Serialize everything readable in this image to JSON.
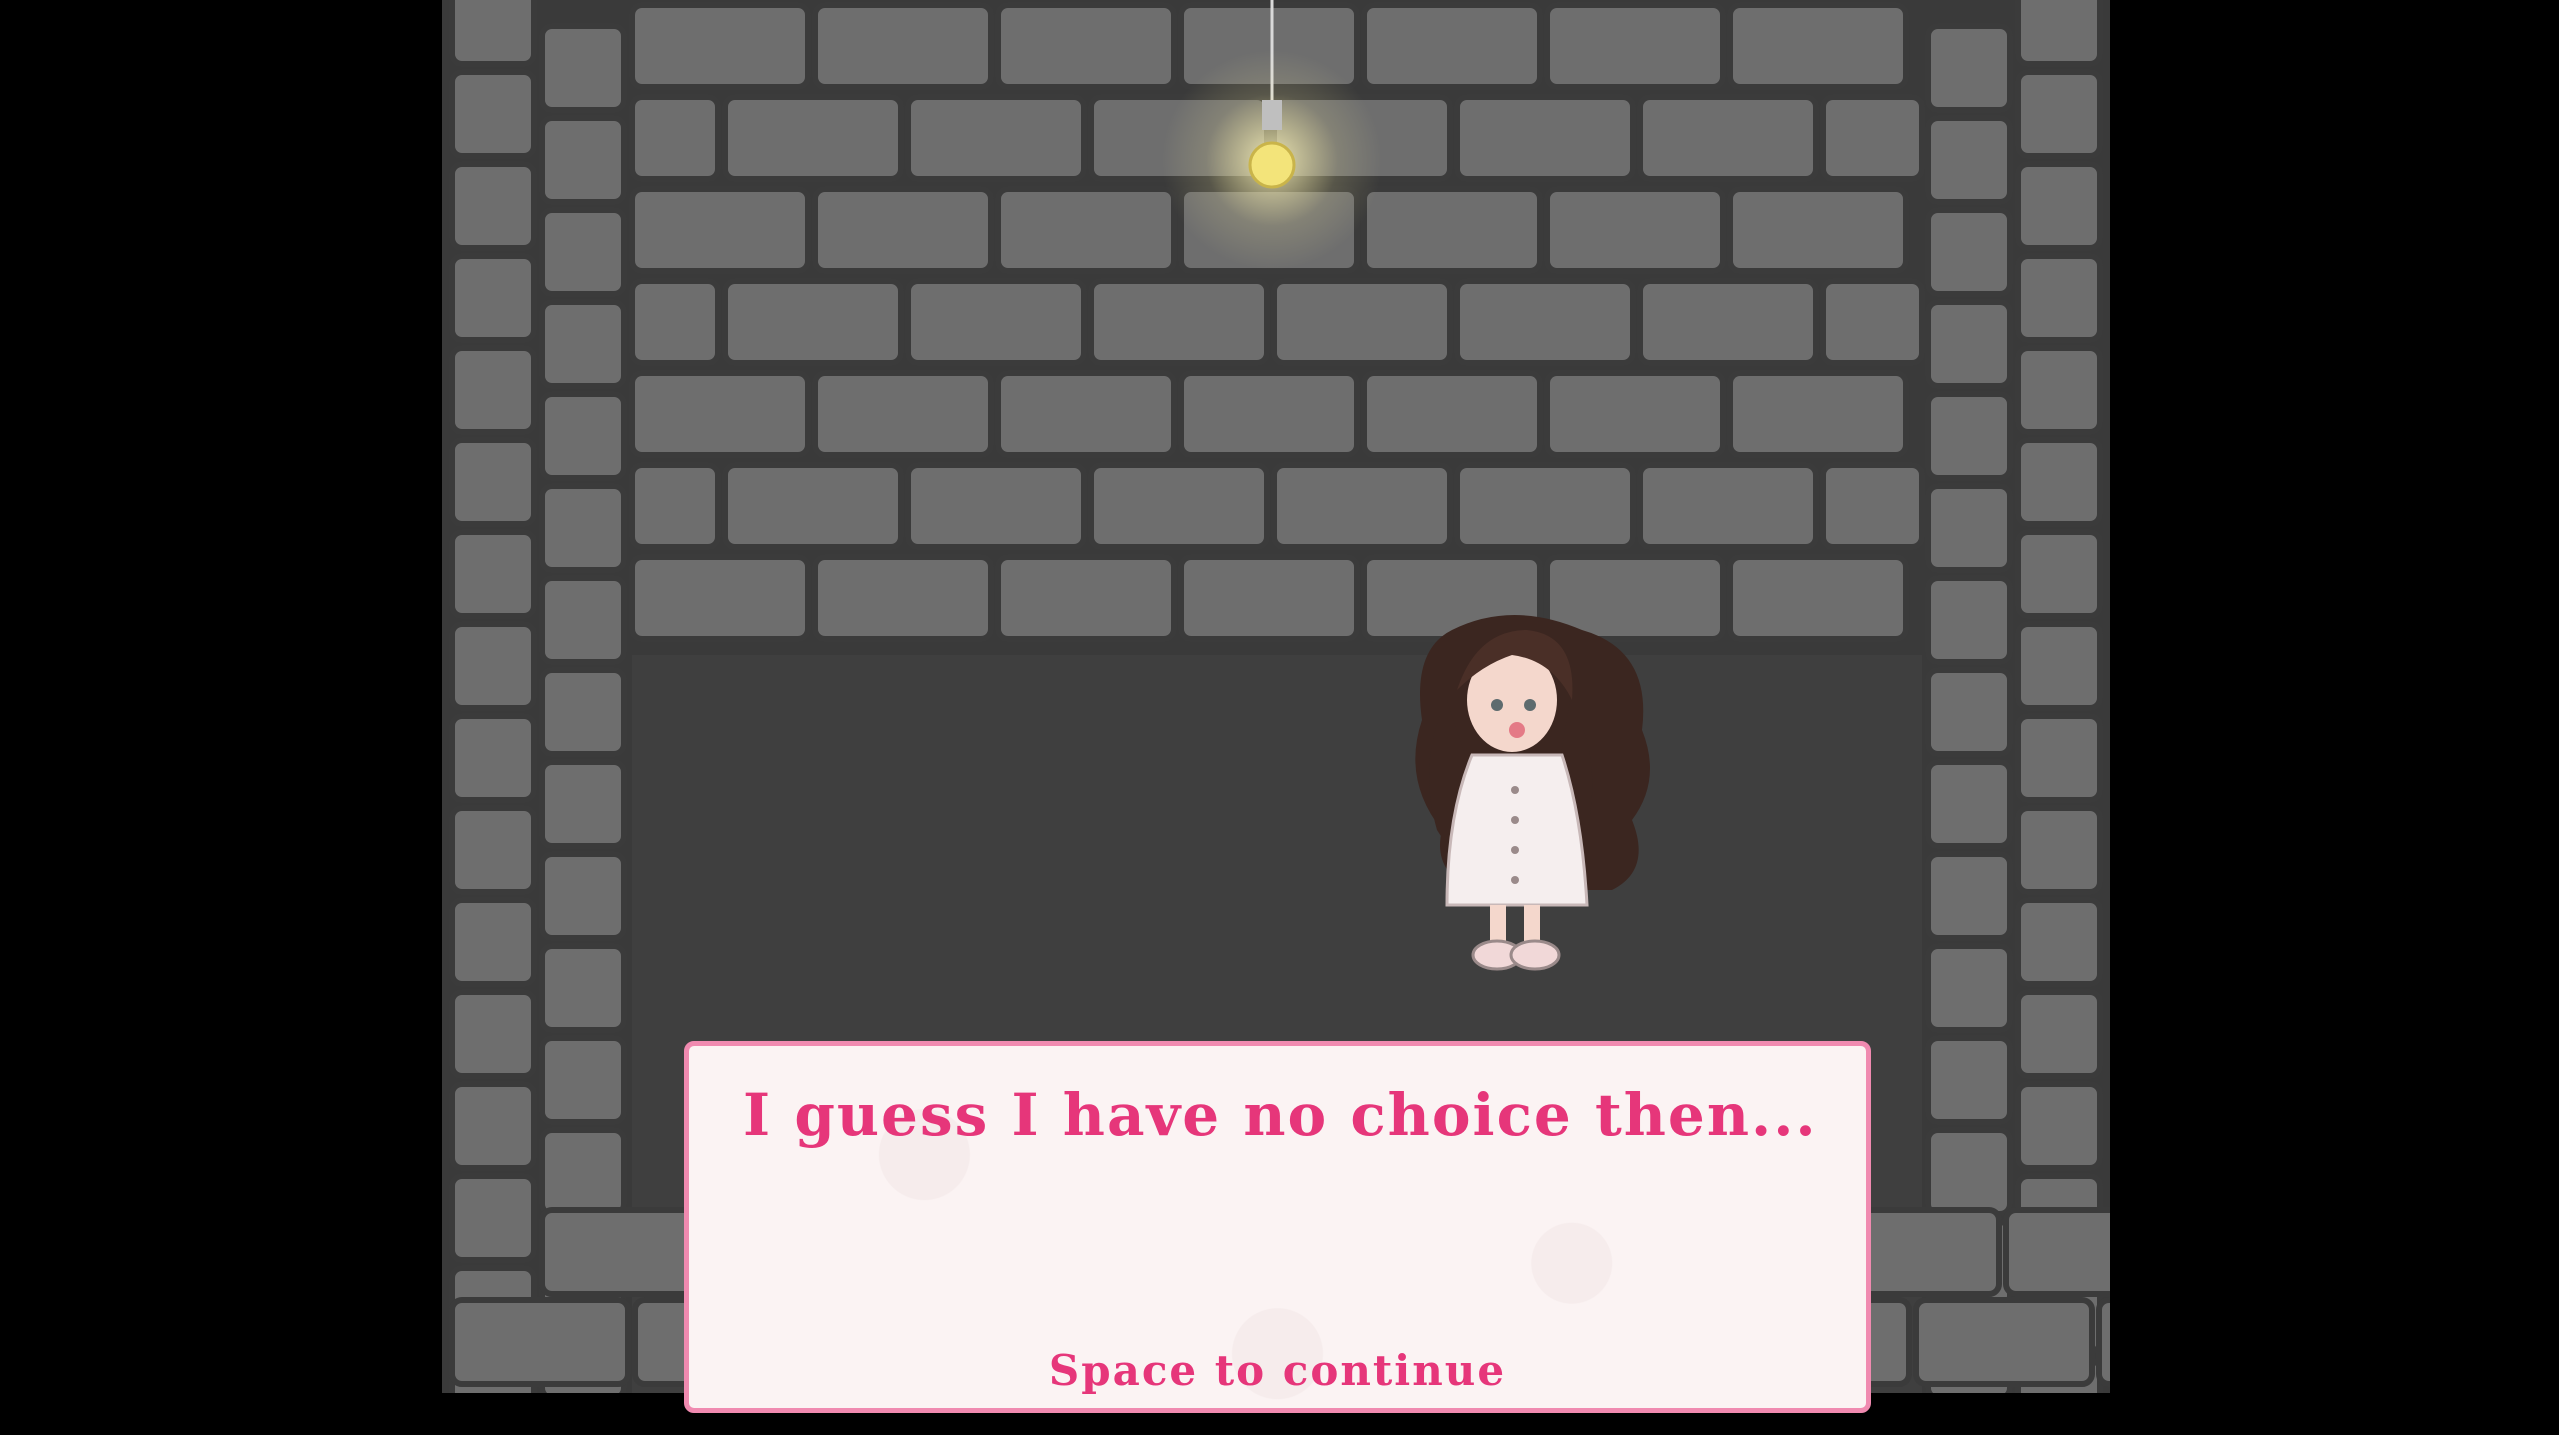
{
  "scene": {
    "background_color": "#000000",
    "wall_color": "#6e6e6e",
    "floor_color": "#3f3f3f",
    "light": "bulb-icon",
    "character": "girl-in-nightgown"
  },
  "dialog": {
    "text": "I guess I have no choice then...",
    "hint": "Space to continue",
    "accent_color": "#e6367a",
    "border_color": "#f08ab0"
  }
}
